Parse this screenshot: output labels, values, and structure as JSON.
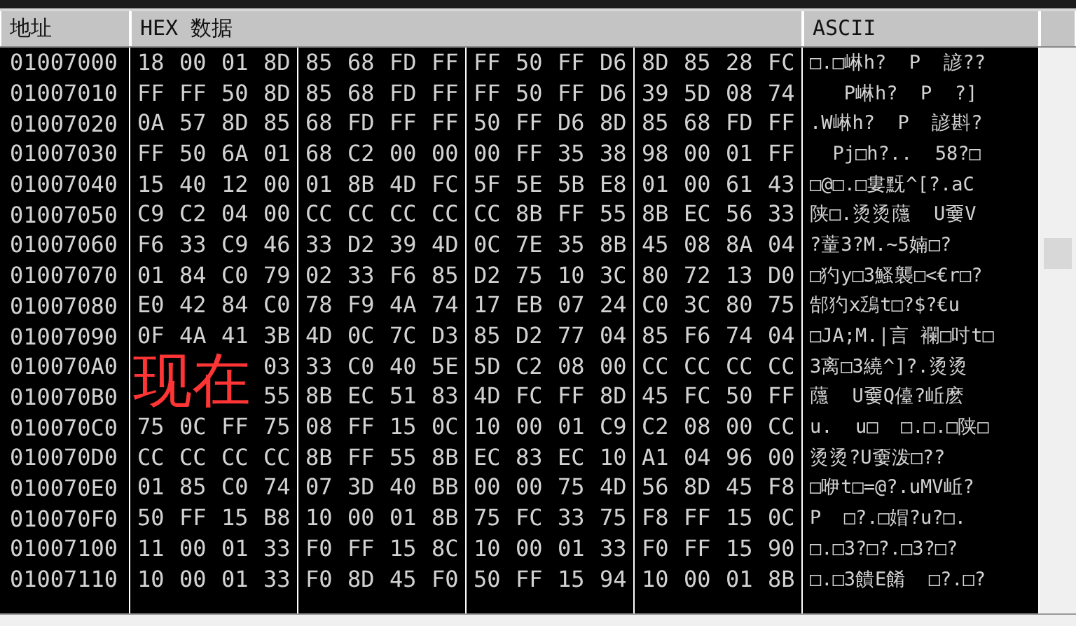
{
  "columns": [
    "地址",
    "HEX 数据",
    "ASCII"
  ],
  "rows": [
    {
      "address": "01007000",
      "bytes": [
        "18",
        "00",
        "01",
        "8D",
        "85",
        "68",
        "FD",
        "FF",
        "FF",
        "50",
        "FF",
        "D6",
        "8D",
        "85",
        "28",
        "FC"
      ],
      "ascii": "□.□崊h?  P  諺??"
    },
    {
      "address": "01007010",
      "bytes": [
        "FF",
        "FF",
        "50",
        "8D",
        "85",
        "68",
        "FD",
        "FF",
        "FF",
        "50",
        "FF",
        "D6",
        "39",
        "5D",
        "08",
        "74"
      ],
      "ascii": "   P崊h?  P  ?]"
    },
    {
      "address": "01007020",
      "bytes": [
        "0A",
        "57",
        "8D",
        "85",
        "68",
        "FD",
        "FF",
        "FF",
        "50",
        "FF",
        "D6",
        "8D",
        "85",
        "68",
        "FD",
        "FF"
      ],
      "ascii": ".W崊h?  P  諺斟?"
    },
    {
      "address": "01007030",
      "bytes": [
        "FF",
        "50",
        "6A",
        "01",
        "68",
        "C2",
        "00",
        "00",
        "00",
        "FF",
        "35",
        "38",
        "98",
        "00",
        "01",
        "FF"
      ],
      "ascii": "  Pj□h?..  58?□"
    },
    {
      "address": "01007040",
      "bytes": [
        "15",
        "40",
        "12",
        "00",
        "01",
        "8B",
        "4D",
        "FC",
        "5F",
        "5E",
        "5B",
        "E8",
        "01",
        "00",
        "61",
        "43"
      ],
      "ascii": "□@□.□婁黖^[?.aC"
    },
    {
      "address": "01007050",
      "bytes": [
        "C9",
        "C2",
        "04",
        "00",
        "CC",
        "CC",
        "CC",
        "CC",
        "CC",
        "8B",
        "FF",
        "55",
        "8B",
        "EC",
        "56",
        "33"
      ],
      "ascii": "陕□.烫烫蘟  U嫑V"
    },
    {
      "address": "01007060",
      "bytes": [
        "F6",
        "33",
        "C9",
        "46",
        "33",
        "D2",
        "39",
        "4D",
        "0C",
        "7E",
        "35",
        "8B",
        "45",
        "08",
        "8A",
        "04"
      ],
      "ascii": "?蕫3?M.~5婻□?"
    },
    {
      "address": "01007070",
      "bytes": [
        "01",
        "84",
        "C0",
        "79",
        "02",
        "33",
        "F6",
        "85",
        "D2",
        "75",
        "10",
        "3C",
        "80",
        "72",
        "13",
        "D0"
      ],
      "ascii": "□犳y□3鰠襲□<€r□?"
    },
    {
      "address": "01007080",
      "bytes": [
        "E0",
        "42",
        "84",
        "C0",
        "78",
        "F9",
        "4A",
        "74",
        "17",
        "EB",
        "07",
        "24",
        "C0",
        "3C",
        "80",
        "75"
      ],
      "ascii": "郜犳x鴔t□?$?€u"
    },
    {
      "address": "01007090",
      "bytes": [
        "0F",
        "4A",
        "41",
        "3B",
        "4D",
        "0C",
        "7C",
        "D3",
        "85",
        "D2",
        "77",
        "04",
        "85",
        "F6",
        "74",
        "04"
      ],
      "ascii": "□JA;M.|言 襴□吋t□"
    },
    {
      "address": "010070A0",
      "bytes": [
        "03",
        "33",
        "C0",
        "40",
        "5E",
        "5D",
        "C2",
        "08",
        "00",
        "CC",
        "CC",
        "CC",
        "CC"
      ],
      "ascii": "3离□3繞^]?.烫烫"
    },
    {
      "address": "010070B0",
      "bytes": [
        "55",
        "8B",
        "EC",
        "51",
        "83",
        "4D",
        "FC",
        "FF",
        "8D",
        "45",
        "FC",
        "50",
        "FF"
      ],
      "ascii": "蘟  U嫑Q儓?岴麽"
    },
    {
      "address": "010070C0",
      "bytes": [
        "75",
        "0C",
        "FF",
        "75",
        "08",
        "FF",
        "15",
        "0C",
        "10",
        "00",
        "01",
        "C9",
        "C2",
        "08",
        "00",
        "CC"
      ],
      "ascii": "u.  u□  □.□.□陕□"
    },
    {
      "address": "010070D0",
      "bytes": [
        "CC",
        "CC",
        "CC",
        "CC",
        "8B",
        "FF",
        "55",
        "8B",
        "EC",
        "83",
        "EC",
        "10",
        "A1",
        "04",
        "96",
        "00"
      ],
      "ascii": "烫烫?U嫑泼□??"
    },
    {
      "address": "010070E0",
      "bytes": [
        "01",
        "85",
        "C0",
        "74",
        "07",
        "3D",
        "40",
        "BB",
        "00",
        "00",
        "75",
        "4D",
        "56",
        "8D",
        "45",
        "F8"
      ],
      "ascii": "□咿t□=@?.uMV岴?"
    },
    {
      "address": "010070F0",
      "bytes": [
        "50",
        "FF",
        "15",
        "B8",
        "10",
        "00",
        "01",
        "8B",
        "75",
        "FC",
        "33",
        "75",
        "F8",
        "FF",
        "15",
        "0C"
      ],
      "ascii": "P  □?.□媢?u?□."
    },
    {
      "address": "01007100",
      "bytes": [
        "11",
        "00",
        "01",
        "33",
        "F0",
        "FF",
        "15",
        "8C",
        "10",
        "00",
        "01",
        "33",
        "F0",
        "FF",
        "15",
        "90"
      ],
      "ascii": "□.□3?□?.□3?□?"
    },
    {
      "address": "01007110",
      "bytes": [
        "10",
        "00",
        "01",
        "33",
        "F0",
        "8D",
        "45",
        "F0",
        "50",
        "FF",
        "15",
        "94",
        "10",
        "00",
        "01",
        "8B"
      ],
      "ascii": "□.□3饋E餚  □?.□?"
    }
  ],
  "overlay_text": "现在"
}
